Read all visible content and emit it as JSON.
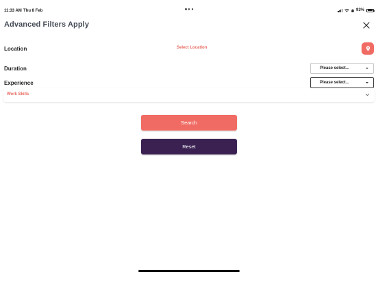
{
  "status_bar": {
    "time": "11:33 AM",
    "date": "Thu 8 Feb",
    "battery_percent": "93%",
    "battery_level": 0.93
  },
  "header": {
    "title": "Advanced Filters Apply",
    "close_icon": "close-icon"
  },
  "filters": {
    "location": {
      "label": "Location",
      "link_text": "Select Location",
      "button_icon": "location-pin-icon"
    },
    "duration": {
      "label": "Duration",
      "selected": "Please select..."
    },
    "experience": {
      "label": "Experience",
      "selected": "Please select..."
    },
    "work_skills": {
      "label": "Work Skills",
      "icon": "chevron-down-icon"
    }
  },
  "actions": {
    "search_label": "Search",
    "reset_label": "Reset"
  },
  "colors": {
    "accent": "#f06b63",
    "secondary": "#3a2152",
    "title_text": "#444a55"
  }
}
